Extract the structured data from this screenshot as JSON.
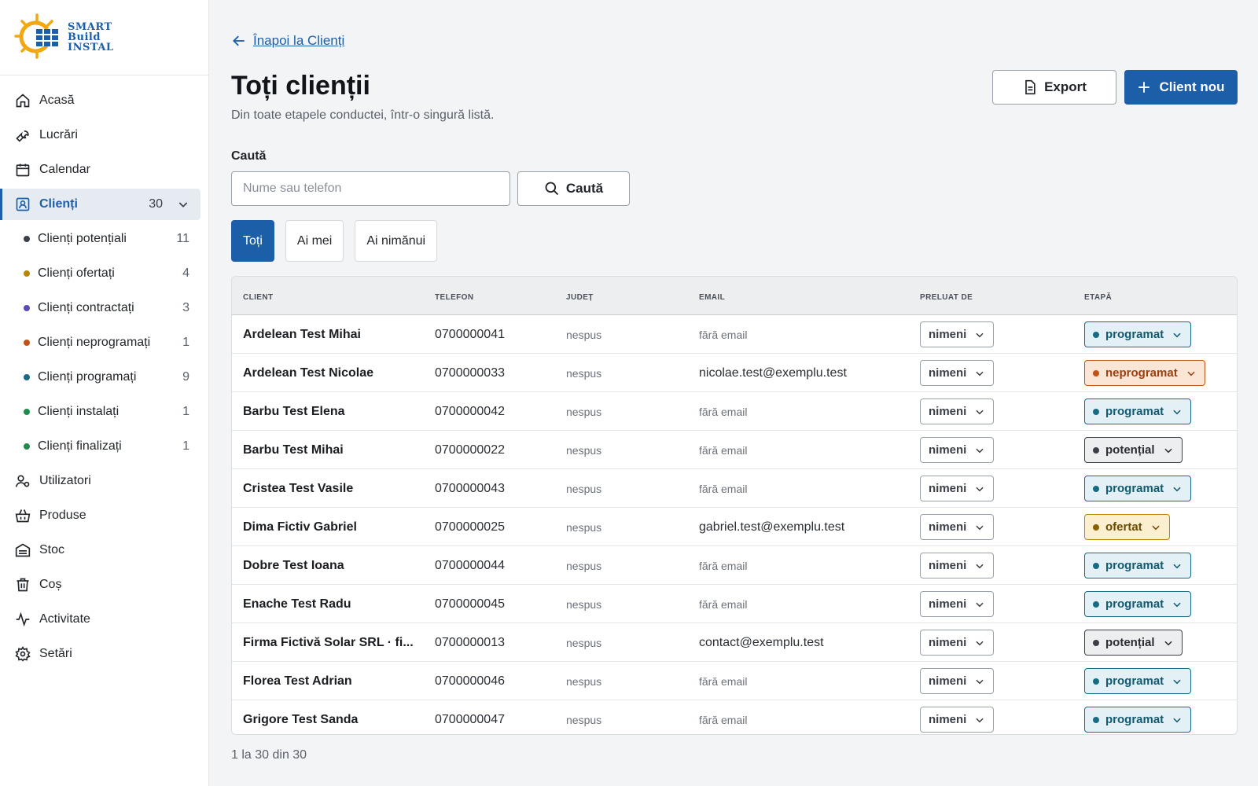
{
  "logo": {
    "line1": "SMART",
    "line2": "Build",
    "line3": "INSTAL"
  },
  "sidebar": {
    "items": [
      {
        "label": "Acasă",
        "icon": "home-icon"
      },
      {
        "label": "Lucrări",
        "icon": "wrench-icon"
      },
      {
        "label": "Calendar",
        "icon": "calendar-icon"
      }
    ],
    "clienti": {
      "label": "Clienți",
      "count": "30",
      "icon": "contact-icon"
    },
    "sub_items": [
      {
        "label": "Clienți potențiali",
        "count": "11",
        "color": "#3b4048"
      },
      {
        "label": "Clienți ofertați",
        "count": "4",
        "color": "#b8860b"
      },
      {
        "label": "Clienți contractați",
        "count": "3",
        "color": "#5b4bb7"
      },
      {
        "label": "Clienți neprogramați",
        "count": "1",
        "color": "#c0531a"
      },
      {
        "label": "Clienți programați",
        "count": "9",
        "color": "#176b84"
      },
      {
        "label": "Clienți instalați",
        "count": "1",
        "color": "#1f8a4c"
      },
      {
        "label": "Clienți finalizați",
        "count": "1",
        "color": "#1f8a4c"
      }
    ],
    "bottom_items": [
      {
        "label": "Utilizatori",
        "icon": "users-icon"
      },
      {
        "label": "Produse",
        "icon": "basket-icon"
      },
      {
        "label": "Stoc",
        "icon": "warehouse-icon"
      },
      {
        "label": "Coș",
        "icon": "trash-icon"
      },
      {
        "label": "Activitate",
        "icon": "activity-icon"
      },
      {
        "label": "Setări",
        "icon": "gear-icon"
      }
    ]
  },
  "header": {
    "back_label": "Înapoi la Clienți",
    "title": "Toți clienții",
    "subtitle": "Din toate etapele conductei, într-o singură listă.",
    "export_label": "Export",
    "new_label": "Client nou"
  },
  "search": {
    "label": "Caută",
    "placeholder": "Nume sau telefon",
    "value": "",
    "button_label": "Caută"
  },
  "filters": [
    {
      "label": "Toți",
      "active": true
    },
    {
      "label": "Ai mei",
      "active": false
    },
    {
      "label": "Ai nimănui",
      "active": false
    }
  ],
  "table": {
    "columns": {
      "client": "CLIENT",
      "telefon": "TELEFON",
      "judet": "JUDEȚ",
      "email": "EMAIL",
      "preluat": "PRELUAT DE",
      "etapa": "ETAPĂ"
    },
    "rows": [
      {
        "name": "Ardelean Test Mihai",
        "phone": "0700000041",
        "judet": "nespus",
        "email": "fără email",
        "email_missing": true,
        "preluat": "nimeni",
        "etapa": "programat"
      },
      {
        "name": "Ardelean Test Nicolae",
        "phone": "0700000033",
        "judet": "nespus",
        "email": "nicolae.test@exemplu.test",
        "email_missing": false,
        "preluat": "nimeni",
        "etapa": "neprogramat"
      },
      {
        "name": "Barbu Test Elena",
        "phone": "0700000042",
        "judet": "nespus",
        "email": "fără email",
        "email_missing": true,
        "preluat": "nimeni",
        "etapa": "programat"
      },
      {
        "name": "Barbu Test Mihai",
        "phone": "0700000022",
        "judet": "nespus",
        "email": "fără email",
        "email_missing": true,
        "preluat": "nimeni",
        "etapa": "potențial"
      },
      {
        "name": "Cristea Test Vasile",
        "phone": "0700000043",
        "judet": "nespus",
        "email": "fără email",
        "email_missing": true,
        "preluat": "nimeni",
        "etapa": "programat"
      },
      {
        "name": "Dima Fictiv Gabriel",
        "phone": "0700000025",
        "judet": "nespus",
        "email": "gabriel.test@exemplu.test",
        "email_missing": false,
        "preluat": "nimeni",
        "etapa": "ofertat"
      },
      {
        "name": "Dobre Test Ioana",
        "phone": "0700000044",
        "judet": "nespus",
        "email": "fără email",
        "email_missing": true,
        "preluat": "nimeni",
        "etapa": "programat"
      },
      {
        "name": "Enache Test Radu",
        "phone": "0700000045",
        "judet": "nespus",
        "email": "fără email",
        "email_missing": true,
        "preluat": "nimeni",
        "etapa": "programat"
      },
      {
        "name": "Firma Fictivă Solar SRL · fi...",
        "phone": "0700000013",
        "judet": "nespus",
        "email": "contact@exemplu.test",
        "email_missing": false,
        "preluat": "nimeni",
        "etapa": "potențial"
      },
      {
        "name": "Florea Test Adrian",
        "phone": "0700000046",
        "judet": "nespus",
        "email": "fără email",
        "email_missing": true,
        "preluat": "nimeni",
        "etapa": "programat"
      },
      {
        "name": "Grigore Test Sanda",
        "phone": "0700000047",
        "judet": "nespus",
        "email": "fără email",
        "email_missing": true,
        "preluat": "nimeni",
        "etapa": "programat"
      }
    ]
  },
  "stage_colors": {
    "programat": {
      "bg": "#e3f0f5",
      "border": "#176b84",
      "dot": "#176b84",
      "text": "#125a70"
    },
    "neprogramat": {
      "bg": "#fbe6d6",
      "border": "#c0531a",
      "dot": "#c0531a",
      "text": "#9b3f10"
    },
    "potențial": {
      "bg": "#eceef0",
      "border": "#3b4048",
      "dot": "#3b4048",
      "text": "#2a2e34"
    },
    "ofertat": {
      "bg": "#fcefcf",
      "border": "#b8860b",
      "dot": "#8a6200",
      "text": "#6b4c00"
    }
  },
  "pagination": "1 la 30 din 30",
  "accent_color": "#1d5ea8"
}
